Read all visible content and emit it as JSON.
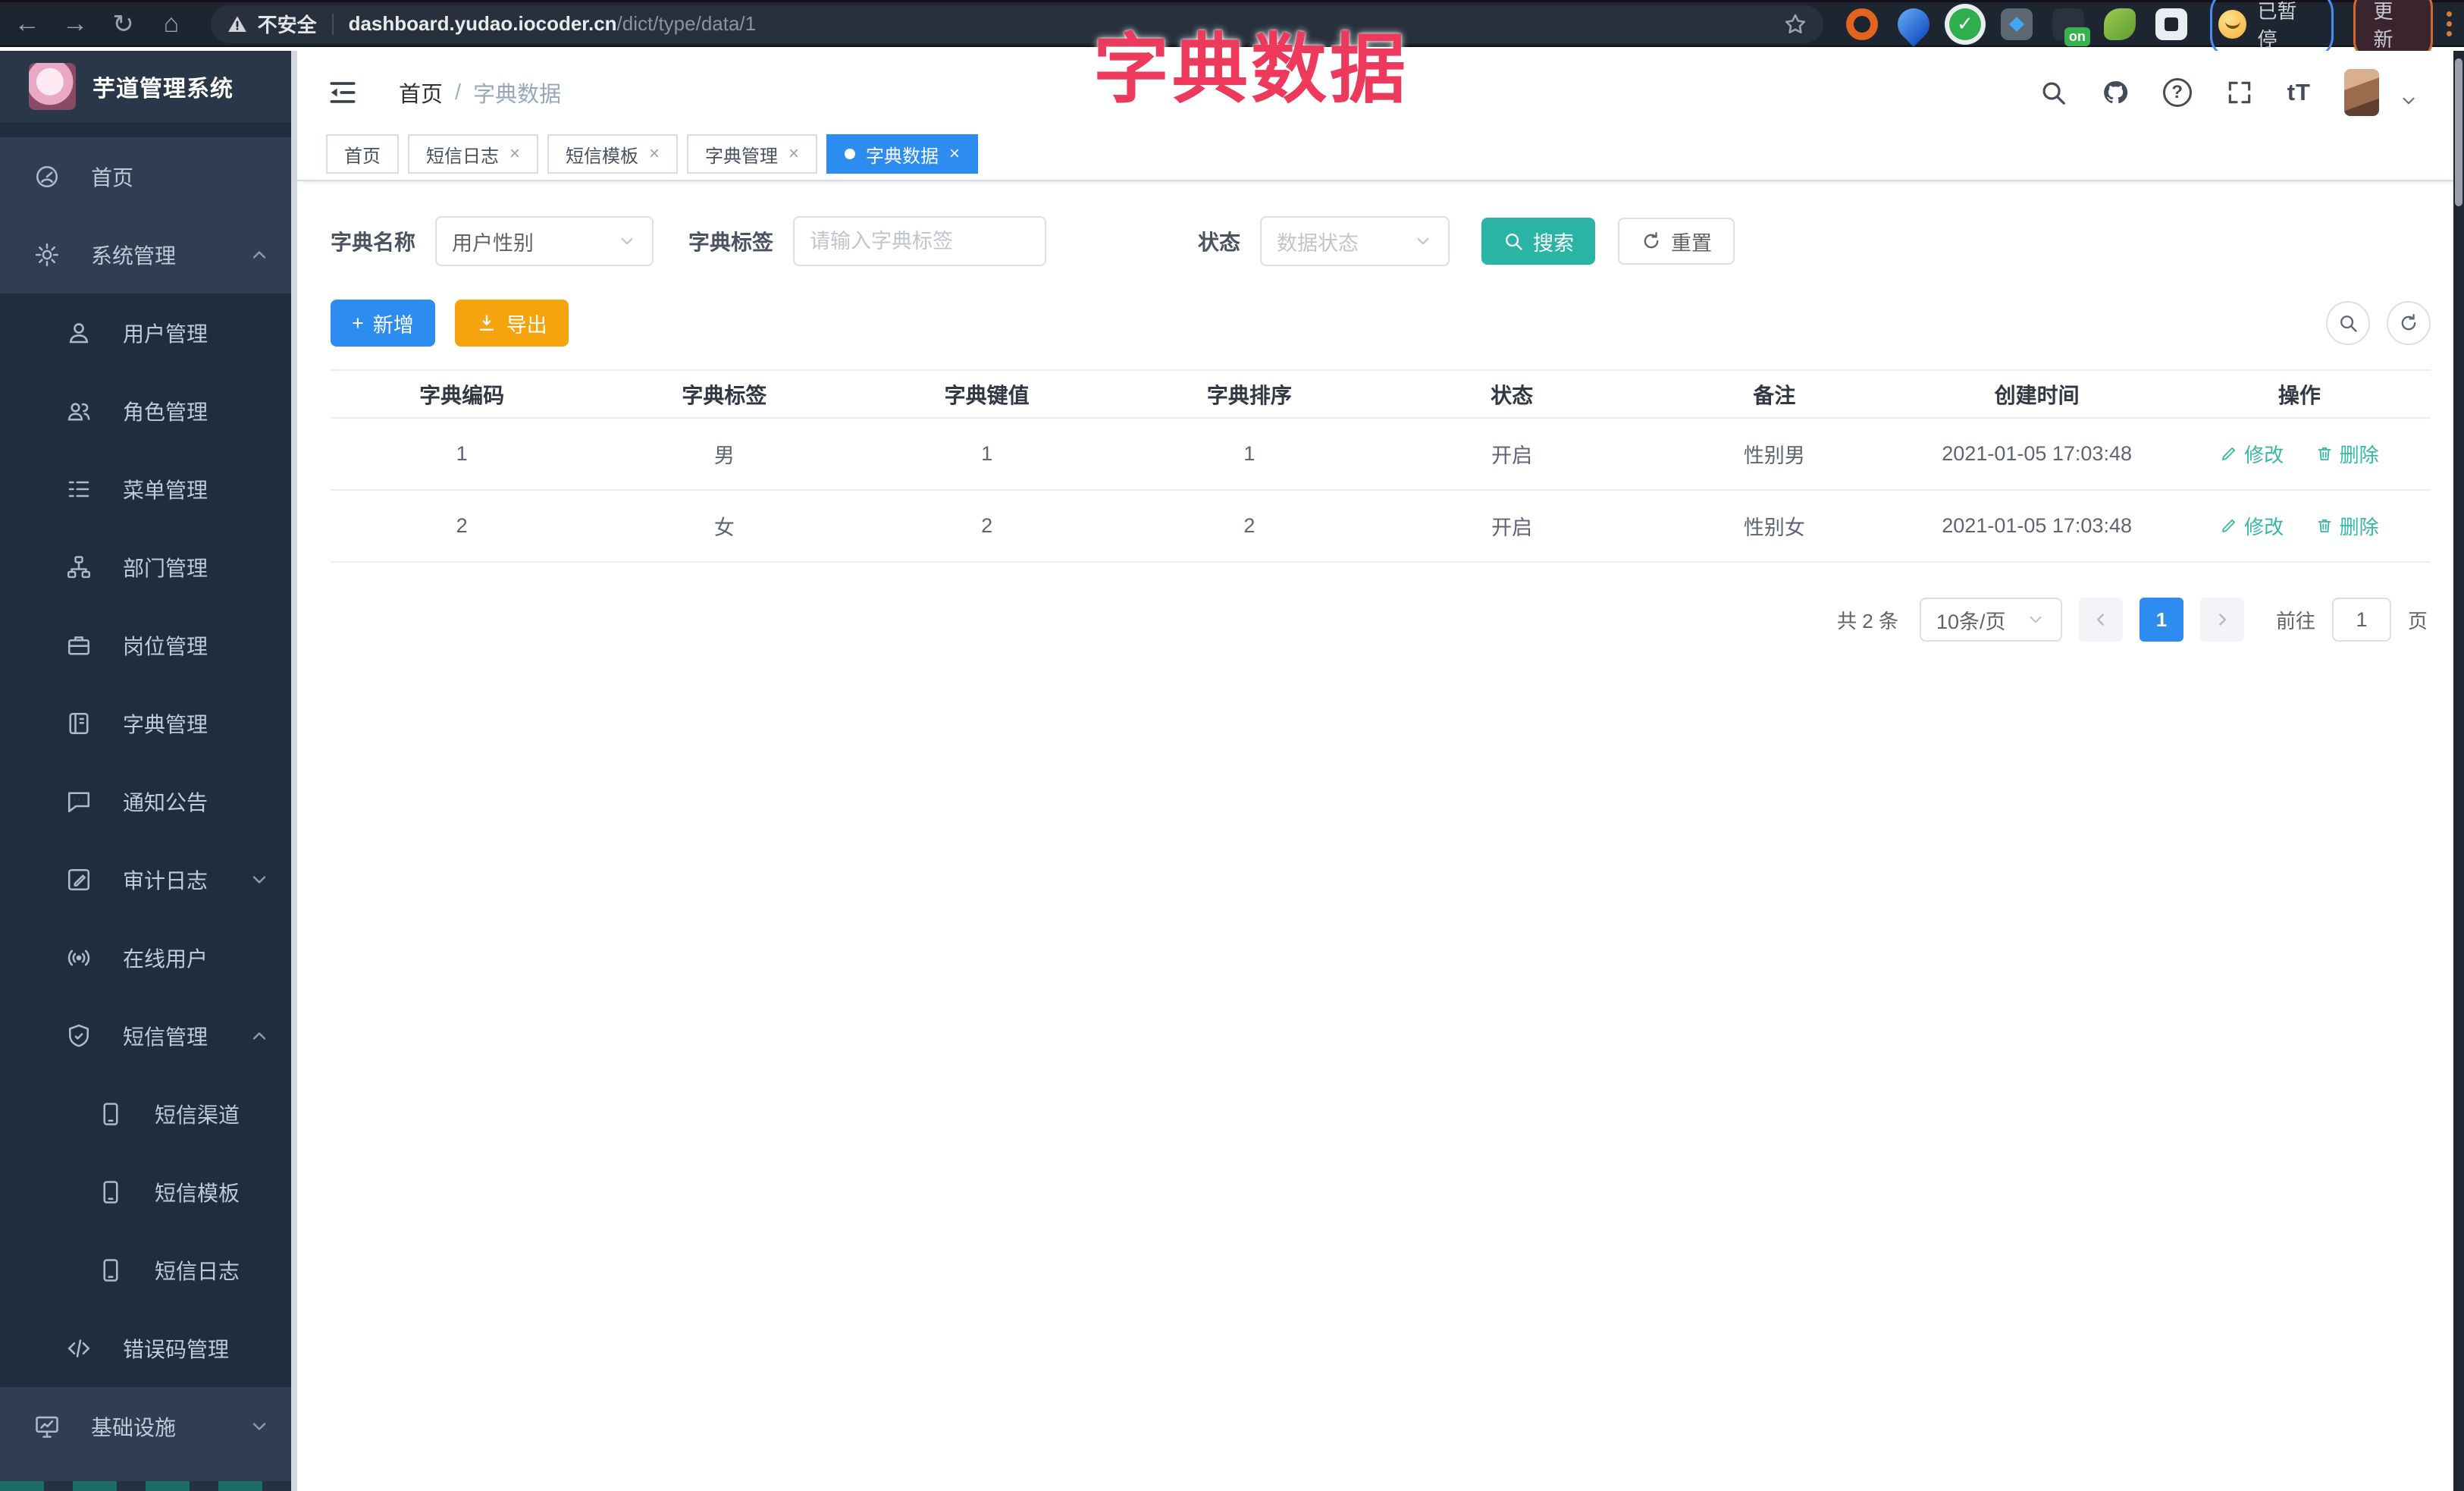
{
  "overlay": {
    "title": "字典数据"
  },
  "icons": {
    "back": "←",
    "forward": "→",
    "reload": "↻",
    "home": "⌂",
    "close": "×",
    "question": "?",
    "font_size": "tT",
    "plus": "+",
    "check": "✓"
  },
  "browser": {
    "security_label": "不安全",
    "url_host": "dashboard.yudao.iocoder.cn",
    "url_path": "/dict/type/data/1",
    "ext_on_badge": "on",
    "profile_status": "已暂停",
    "update_label": "更新"
  },
  "sidebar": {
    "app_title": "芋道管理系统",
    "items": [
      {
        "label": "首页"
      },
      {
        "label": "系统管理"
      },
      {
        "label": "用户管理"
      },
      {
        "label": "角色管理"
      },
      {
        "label": "菜单管理"
      },
      {
        "label": "部门管理"
      },
      {
        "label": "岗位管理"
      },
      {
        "label": "字典管理"
      },
      {
        "label": "通知公告"
      },
      {
        "label": "审计日志"
      },
      {
        "label": "在线用户"
      },
      {
        "label": "短信管理"
      },
      {
        "label": "短信渠道"
      },
      {
        "label": "短信模板"
      },
      {
        "label": "短信日志"
      },
      {
        "label": "错误码管理"
      },
      {
        "label": "基础设施"
      }
    ]
  },
  "header": {
    "breadcrumb_home": "首页",
    "breadcrumb_sep": "/",
    "breadcrumb_current": "字典数据"
  },
  "tabs": [
    {
      "label": "首页"
    },
    {
      "label": "短信日志"
    },
    {
      "label": "短信模板"
    },
    {
      "label": "字典管理"
    },
    {
      "label": "字典数据"
    }
  ],
  "filters": {
    "dict_name_label": "字典名称",
    "dict_name_value": "用户性别",
    "dict_label_label": "字典标签",
    "dict_label_placeholder": "请输入字典标签",
    "status_label": "状态",
    "status_placeholder": "数据状态",
    "search_label": "搜索",
    "reset_label": "重置"
  },
  "toolbar": {
    "add_label": "新增",
    "export_label": "导出"
  },
  "table": {
    "columns": [
      "字典编码",
      "字典标签",
      "字典键值",
      "字典排序",
      "状态",
      "备注",
      "创建时间",
      "操作"
    ],
    "rows": [
      {
        "code": "1",
        "label": "男",
        "value": "1",
        "sort": "1",
        "status": "开启",
        "remark": "性别男",
        "created": "2021-01-05 17:03:48"
      },
      {
        "code": "2",
        "label": "女",
        "value": "2",
        "sort": "2",
        "status": "开启",
        "remark": "性别女",
        "created": "2021-01-05 17:03:48"
      }
    ],
    "edit_label": "修改",
    "delete_label": "删除"
  },
  "pagination": {
    "total_label": "共 2 条",
    "page_size_label": "10条/页",
    "current_page": "1",
    "goto_label": "前往",
    "goto_value": "1",
    "page_unit": "页"
  }
}
